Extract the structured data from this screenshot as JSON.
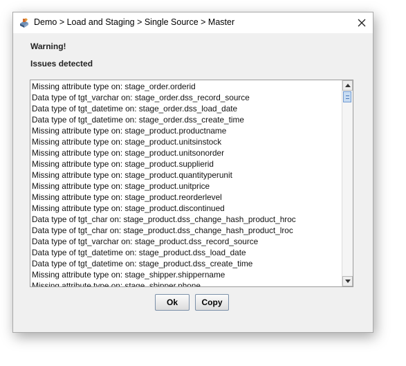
{
  "window": {
    "title": "Demo > Load and Staging > Single Source > Master",
    "icon": "app-icon",
    "close_icon": "close-icon"
  },
  "dialog": {
    "warning_label": "Warning!",
    "issues_label": "Issues detected",
    "issues": [
      "Missing attribute type on: stage_order.orderid",
      "Data type of tgt_varchar on: stage_order.dss_record_source",
      "Data type of tgt_datetime on: stage_order.dss_load_date",
      "Data type of tgt_datetime on: stage_order.dss_create_time",
      "Missing attribute type on: stage_product.productname",
      "Missing attribute type on: stage_product.unitsinstock",
      "Missing attribute type on: stage_product.unitsonorder",
      "Missing attribute type on: stage_product.supplierid",
      "Missing attribute type on: stage_product.quantityperunit",
      "Missing attribute type on: stage_product.unitprice",
      "Missing attribute type on: stage_product.reorderlevel",
      "Missing attribute type on: stage_product.discontinued",
      "Data type of tgt_char on: stage_product.dss_change_hash_product_hroc",
      "Data type of tgt_char on: stage_product.dss_change_hash_product_lroc",
      "Data type of tgt_varchar on: stage_product.dss_record_source",
      "Data type of tgt_datetime on: stage_product.dss_load_date",
      "Data type of tgt_datetime on: stage_product.dss_create_time",
      "Missing attribute type on: stage_shipper.shippername",
      "Missing attribute type on: stage_shipper.phone"
    ]
  },
  "buttons": {
    "ok_label": "Ok",
    "copy_label": "Copy"
  }
}
